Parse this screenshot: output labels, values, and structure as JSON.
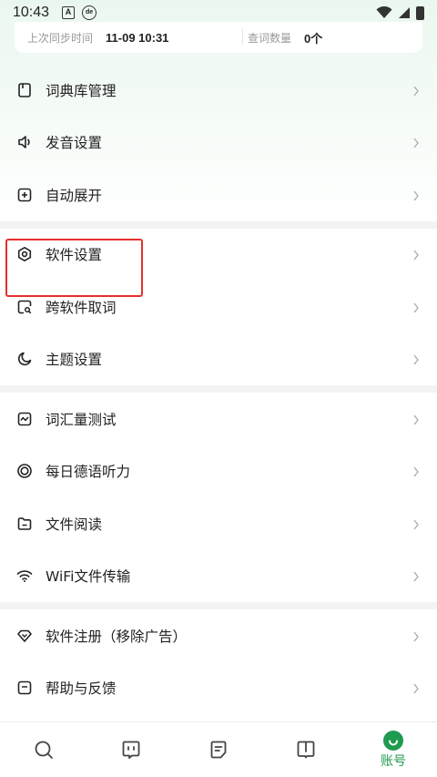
{
  "status_bar": {
    "time": "10:43",
    "icon_a": "A",
    "icon_de": "de"
  },
  "sync": {
    "last_sync_label": "上次同步时间",
    "last_sync_value": "11-09 10:31",
    "lookup_count_label": "查词数量",
    "lookup_count_value": "0个"
  },
  "menu": {
    "group1": [
      {
        "icon": "dictionary-icon",
        "label": "词典库管理"
      },
      {
        "icon": "speaker-icon",
        "label": "发音设置"
      },
      {
        "icon": "plus-square-icon",
        "label": "自动展开"
      }
    ],
    "group2": [
      {
        "icon": "hexagon-gear-icon",
        "label": "软件设置"
      },
      {
        "icon": "search-square-icon",
        "label": "跨软件取词"
      },
      {
        "icon": "moon-icon",
        "label": "主题设置"
      }
    ],
    "group3": [
      {
        "icon": "wave-chart-icon",
        "label": "词汇量测试"
      },
      {
        "icon": "target-icon",
        "label": "每日德语听力"
      },
      {
        "icon": "folder-icon",
        "label": "文件阅读"
      },
      {
        "icon": "wifi-icon",
        "label": "WiFi文件传输"
      }
    ],
    "group4": [
      {
        "icon": "diamond-icon",
        "label": "软件注册（移除广告）"
      },
      {
        "icon": "help-icon",
        "label": "帮助与反馈"
      }
    ]
  },
  "bottom_nav": {
    "items": [
      {
        "icon": "search-icon"
      },
      {
        "icon": "chat-face-icon"
      },
      {
        "icon": "note-icon"
      },
      {
        "icon": "book-icon"
      },
      {
        "icon": "account-icon",
        "label": "账号",
        "active": true
      }
    ],
    "active_color": "#1f9a4e"
  },
  "colors": {
    "highlight": "#e5302d",
    "accent": "#1f9a4e"
  }
}
